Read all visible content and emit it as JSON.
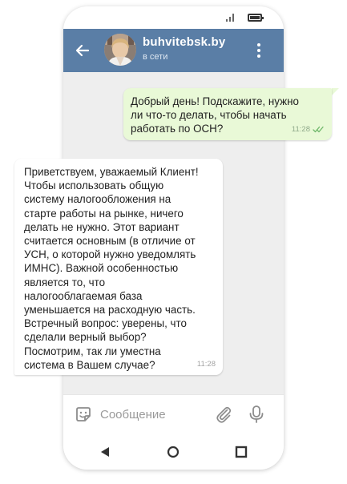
{
  "header": {
    "title": "buhvitebsk.by",
    "status": "в сети"
  },
  "messages": [
    {
      "direction": "outgoing",
      "lines": [
        "Добрый день! Подскажите, нужно",
        "ли что-то делать, чтобы начать",
        "работать по ОСН?"
      ],
      "time": "11:28",
      "read": true
    },
    {
      "direction": "incoming",
      "lines": [
        "Приветствуем, уважаемый Клиент!",
        "Чтобы использовать общую",
        "систему налогообложения на",
        "старте работы на рынке, ничего",
        "делать не нужно. Этот вариант",
        "считается основным (в отличие от",
        "УСН, о которой нужно уведомлять",
        "ИМНС). Важной особенностью",
        "является то, что",
        "налогооблагаемая база",
        "уменьшается на расходную часть.",
        "Встречный вопрос: уверены, что",
        "сделали верный выбор?",
        "Посмотрим, так ли уместна",
        "система в Вашем случае?"
      ],
      "time": "11:28"
    }
  ],
  "composer": {
    "placeholder": "Сообщение"
  },
  "icons": {
    "back": "arrow-left-icon",
    "more": "more-vertical-icon",
    "sticker": "sticker-icon",
    "attach": "paperclip-icon",
    "mic": "microphone-icon",
    "nav_back": "triangle-back-icon",
    "nav_home": "circle-home-icon",
    "nav_recent": "square-recent-icon",
    "signal": "signal-icon",
    "battery": "battery-icon"
  },
  "colors": {
    "header": "#5a7ea6",
    "chat_background": "#eeeeee",
    "outgoing_bubble": "#e9f9d7",
    "incoming_bubble": "#ffffff",
    "read_ticks": "#6fb86a"
  }
}
